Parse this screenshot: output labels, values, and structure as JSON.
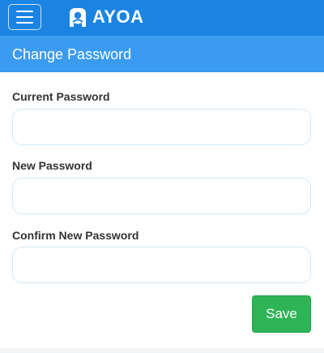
{
  "app": {
    "brand": "AYOA",
    "logo_icon": "ayoa-logo-icon",
    "menu_icon": "hamburger-menu-icon",
    "colors": {
      "topbar": "#1b84e3",
      "header": "#3a9bf1",
      "save": "#2eb456"
    }
  },
  "page": {
    "title": "Change Password"
  },
  "form": {
    "current_password": {
      "label": "Current Password",
      "value": "",
      "placeholder": ""
    },
    "new_password": {
      "label": "New Password",
      "value": "",
      "placeholder": ""
    },
    "confirm_password": {
      "label": "Confirm New Password",
      "value": "",
      "placeholder": ""
    },
    "save_label": "Save"
  }
}
